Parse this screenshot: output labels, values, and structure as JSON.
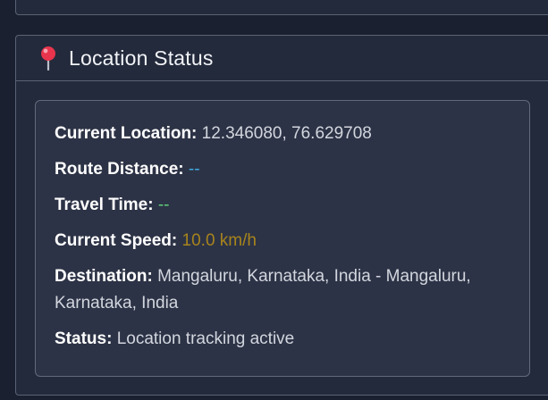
{
  "panel": {
    "title": "Location Status",
    "icon": "map-pin-icon"
  },
  "rows": {
    "current_location": {
      "label": "Current Location:",
      "value": "12.346080, 76.629708"
    },
    "route_distance": {
      "label": "Route Distance:",
      "value": "--"
    },
    "travel_time": {
      "label": "Travel Time:",
      "value": "--"
    },
    "current_speed": {
      "label": "Current Speed:",
      "value": "10.0 km/h"
    },
    "destination": {
      "label": "Destination:",
      "value": "Mangaluru, Karnataka, India - Mangaluru, Karnataka, India"
    },
    "status": {
      "label": "Status:",
      "value": "Location tracking active"
    }
  },
  "colors": {
    "background": "#1b2030",
    "panel": "#232a3b",
    "info_box": "#2d3346",
    "distance": "#3eaadf",
    "time": "#5fcf7a",
    "speed": "#a7841c",
    "pin": "#e8354d"
  }
}
